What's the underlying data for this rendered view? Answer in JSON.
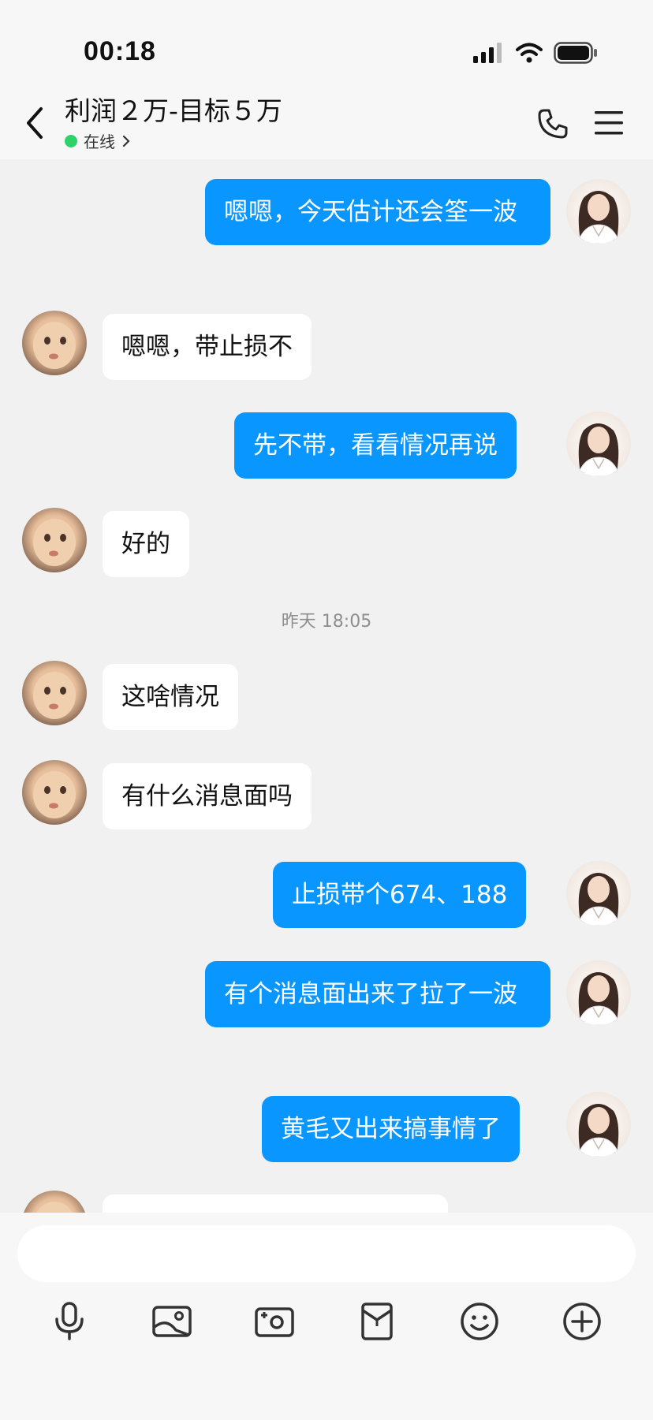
{
  "status_bar": {
    "time": "00:18"
  },
  "header": {
    "title": "利润２万-目标５万",
    "status": "在线"
  },
  "messages": [
    {
      "side": "right",
      "text": "嗯嗯，今天估计还会筌一波"
    },
    {
      "side": "left",
      "text": "嗯嗯，带止损不"
    },
    {
      "side": "right",
      "text": "先不带，看看情况再说"
    },
    {
      "side": "left",
      "text": "好的"
    },
    {
      "type": "timestamp",
      "text": "昨天 18:05"
    },
    {
      "side": "left",
      "text": "这啥情况"
    },
    {
      "side": "left",
      "text": "有什么消息面吗"
    },
    {
      "side": "right",
      "text": "止损带个674、188"
    },
    {
      "side": "right",
      "text": "有个消息面出来了拉了一波"
    },
    {
      "side": "right",
      "text": "黄毛又出来搞事情了"
    },
    {
      "side": "left",
      "text": ""
    }
  ],
  "input": {
    "placeholder": ""
  },
  "toolbar": {
    "icons": [
      "microphone-icon",
      "image-icon",
      "camera-icon",
      "red-envelope-icon",
      "emoji-icon",
      "plus-icon"
    ]
  },
  "colors": {
    "sent_bubble": "#0a96ff",
    "received_bubble": "#ffffff",
    "background": "#f1f1f1",
    "online": "#2fd16a"
  }
}
